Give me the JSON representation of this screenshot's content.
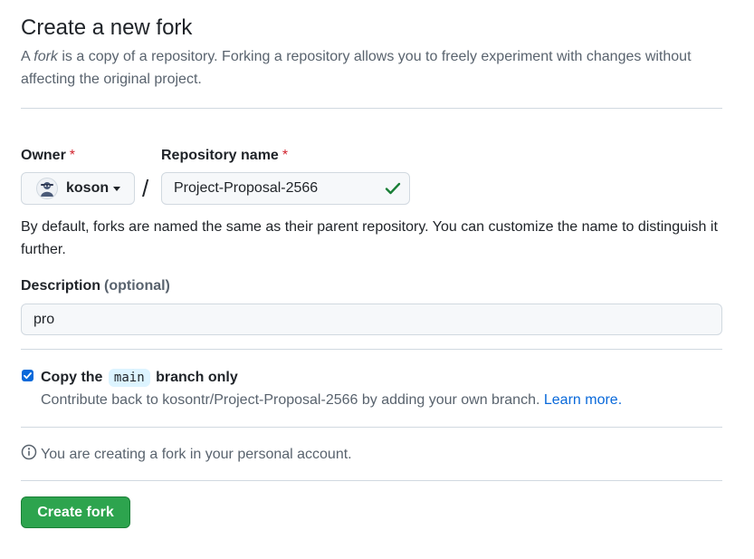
{
  "header": {
    "title": "Create a new fork",
    "intro_prefix": "A",
    "intro_em": "fork",
    "intro_rest": "is a copy of a repository. Forking a repository allows you to freely experiment with changes without affecting the original project."
  },
  "form": {
    "owner_label": "Owner",
    "required_mark": "*",
    "owner_value": "koson",
    "separator": "/",
    "repo_label": "Repository name",
    "repo_value": "Project-Proposal-2566",
    "repo_help": "By default, forks are named the same as their parent repository. You can customize the name to distinguish it further.",
    "description_label": "Description",
    "description_optional": "(optional)",
    "description_value": "pro"
  },
  "copy_branch": {
    "checked": true,
    "label_prefix": "Copy the",
    "branch": "main",
    "label_suffix": "branch only",
    "sub_text": "Contribute back to kosontr/Project-Proposal-2566 by adding your own branch.",
    "learn_more": "Learn more."
  },
  "info": {
    "text": "You are creating a fork in your personal account."
  },
  "actions": {
    "create_label": "Create fork"
  },
  "colors": {
    "primary_button": "#2da44e",
    "link": "#0969da",
    "required": "#d1242f",
    "success_check": "#1a7f37"
  },
  "icons": {
    "avatar": "owner-avatar-icon",
    "caret": "caret-down-icon",
    "valid": "check-icon",
    "info": "info-icon",
    "checkbox": "checkbox-checked-icon"
  }
}
